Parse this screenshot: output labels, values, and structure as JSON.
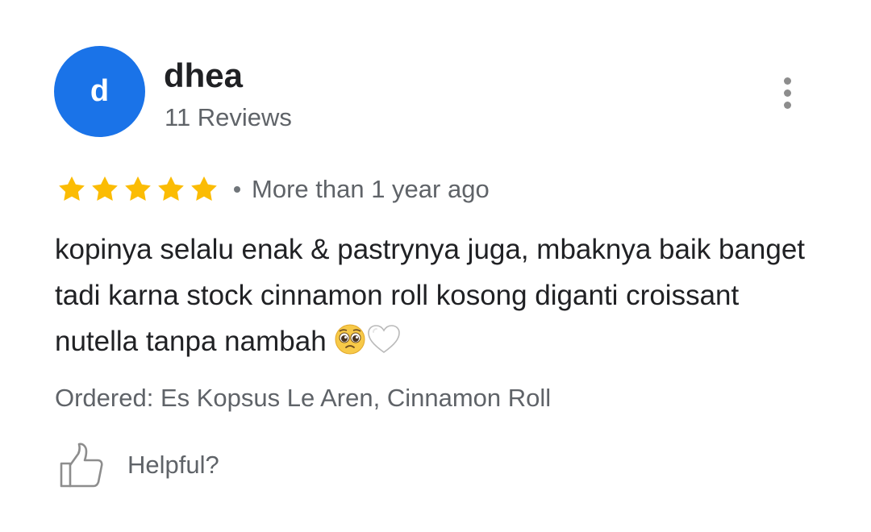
{
  "reviewer": {
    "avatar_letter": "d",
    "name": "dhea",
    "review_count": "11 Reviews"
  },
  "rating": {
    "stars": 5,
    "max_stars": 5,
    "time": "More than 1 year ago"
  },
  "review": {
    "text": "kopinya selalu enak & pastrynya juga, mbaknya baik banget tadi karna stock cinnamon roll kosong diganti croissant nutella tanpa nambah"
  },
  "ordered": "Ordered: Es Kopsus Le Aren, Cinnamon Roll",
  "actions": {
    "helpful_label": "Helpful?"
  },
  "icons": {
    "more": "more-vert-icon",
    "star": "star-icon",
    "thumb": "thumbs-up-icon",
    "emoji_1": "pleading-face-emoji",
    "emoji_2": "white-heart-emoji"
  },
  "colors": {
    "avatar": "#1a73e8",
    "star": "#fbbc04",
    "text_primary": "#202124",
    "text_secondary": "#5f6368"
  }
}
